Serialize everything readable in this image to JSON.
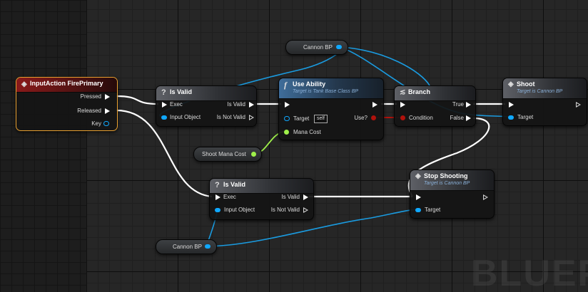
{
  "nodes": {
    "input_action": {
      "title": "InputAction FirePrimary",
      "pins": {
        "pressed": "Pressed",
        "released": "Released",
        "key": "Key"
      }
    },
    "is_valid_1": {
      "title": "Is Valid",
      "icon": "?",
      "pins": {
        "exec": "Exec",
        "input_object": "Input Object",
        "is_valid": "Is Valid",
        "is_not_valid": "Is Not Valid"
      }
    },
    "use_ability": {
      "title": "Use Ability",
      "icon": "f",
      "subtitle": "Target is Tank Base Class BP",
      "pins": {
        "target": "Target",
        "self": "self",
        "mana_cost": "Mana Cost",
        "use": "Use?"
      }
    },
    "branch": {
      "title": "Branch",
      "pins": {
        "true": "True",
        "false": "False",
        "condition": "Condition"
      }
    },
    "shoot": {
      "title": "Shoot",
      "subtitle": "Target is Cannon BP",
      "pins": {
        "target": "Target"
      }
    },
    "is_valid_2": {
      "title": "Is Valid",
      "icon": "?",
      "pins": {
        "exec": "Exec",
        "input_object": "Input Object",
        "is_valid": "Is Valid",
        "is_not_valid": "Is Not Valid"
      }
    },
    "stop_shooting": {
      "title": "Stop Shooting",
      "subtitle": "Target is Cannon BP",
      "pins": {
        "target": "Target"
      }
    }
  },
  "variables": {
    "cannon_bp_top": "Cannon BP",
    "cannon_bp_bottom": "Cannon BP",
    "shoot_mana_cost": "Shoot Mana Cost"
  },
  "watermark": "BLUEP",
  "colors": {
    "exec": "#ffffff",
    "object": "#0fa8ff",
    "float": "#9ff04a",
    "bool": "#b0120c"
  }
}
